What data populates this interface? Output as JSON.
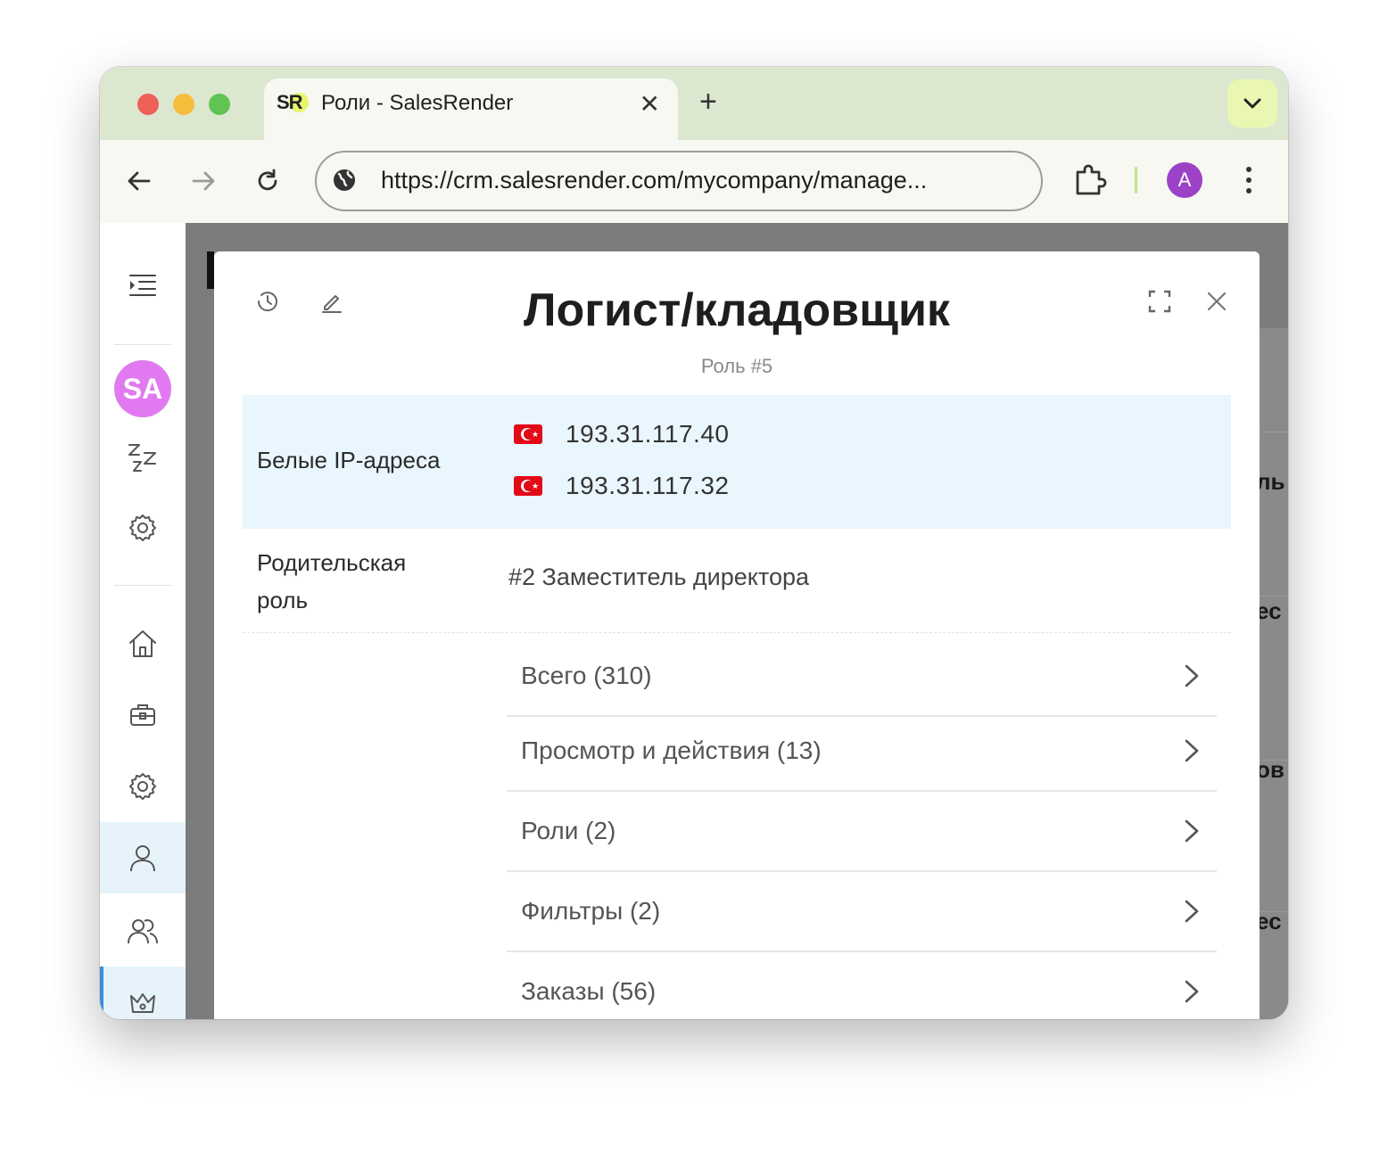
{
  "browser": {
    "tab_title": "Роли - SalesRender",
    "favicon_text": "SR",
    "url": "https://crm.salesrender.com/mycompany/manage...",
    "profile_initial": "A",
    "new_tab_label": "+",
    "tab_close_label": "✕"
  },
  "sidebar": {
    "user_initials": "SA",
    "icons": [
      "menu-toggle-icon",
      "sleep-icon",
      "settings-icon",
      "home-icon",
      "briefcase-icon",
      "settings-icon",
      "user-icon",
      "users-icon",
      "crown-icon"
    ]
  },
  "background": {
    "fragments": [
      "ль",
      "ес",
      "ов",
      "ес"
    ]
  },
  "modal": {
    "title": "Логист/кладовщик",
    "subtitle": "Роль #5",
    "fields": {
      "whitelist_label": "Белые IP-адреса",
      "ips": [
        "193.31.117.40",
        "193.31.117.32"
      ],
      "parent_label_line1": "Родительская",
      "parent_label_line2": "роль",
      "parent_value": "#2 Заместитель директора"
    },
    "permissions": [
      {
        "label": "Всего  (310)"
      },
      {
        "label": "Просмотр и действия (13)"
      },
      {
        "label": "Роли (2)"
      },
      {
        "label": "Фильтры (2)"
      },
      {
        "label": "Заказы (56)"
      }
    ]
  },
  "colors": {
    "accent": "#3b8ed8",
    "highlight_row": "#e9f6fd",
    "avatar": "#e17af0",
    "profile": "#9b42c6"
  }
}
